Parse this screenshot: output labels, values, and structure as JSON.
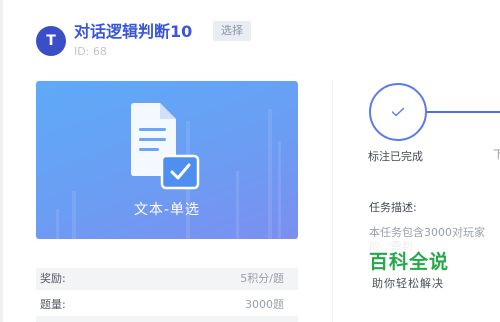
{
  "task": {
    "avatar_letter": "T",
    "title": "对话逻辑判断10",
    "select_label": "选择",
    "id_text": "ID: 68"
  },
  "banner": {
    "label": "文本-单选",
    "icon": "document-check-icon"
  },
  "info": [
    {
      "key": "奖励:",
      "value": "5积分/题"
    },
    {
      "key": "题量:",
      "value": "3000题"
    }
  ],
  "steps": {
    "current_label": "标注已完成",
    "next_label_partial": "下"
  },
  "description": {
    "label": "任务描述:",
    "text": "本任务包含3000对玩家的...需判"
  },
  "watermark": {
    "title": "百科全说",
    "subtitle": "助你轻松解决"
  },
  "colors": {
    "accent": "#3a57d8",
    "avatar": "#3a4fc7",
    "banner_start": "#5eaaf8",
    "banner_end": "#7b8ff0",
    "watermark_green": "#26a84a"
  }
}
